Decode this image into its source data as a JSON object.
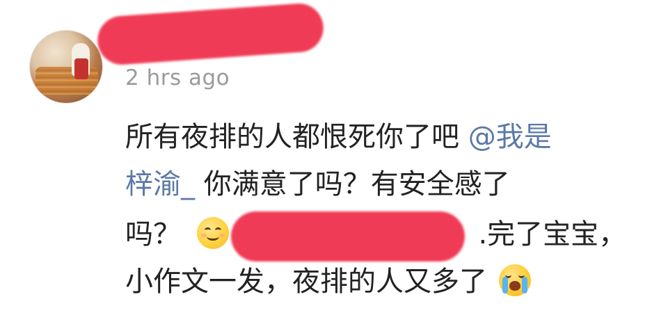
{
  "comment": {
    "timestamp": "2 hrs ago",
    "line1_text": "所有夜排的人都恨死你了吧 ",
    "line1_mention": "@我是",
    "line2_mention": "梓渝_",
    "line2_text": " 你满意了吗？有安全感了",
    "line3_text": "吗？",
    "line3_tail": ".完了宝宝，",
    "line4_text": "小作文一发，夜排的人又多了",
    "emoji_smile": "smiling-face-icon",
    "emoji_cry": "crying-face-icon"
  },
  "colors": {
    "mention": "#5a79a8",
    "timestamp": "#9a9a9a",
    "redaction": "#f0314d",
    "text": "#222222"
  }
}
